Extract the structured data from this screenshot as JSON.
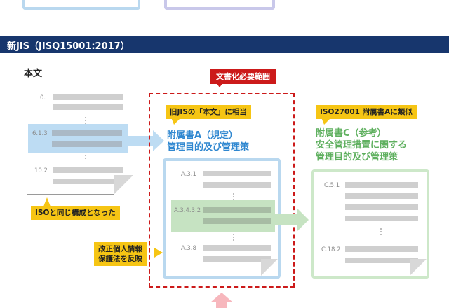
{
  "section": {
    "title": "新JIS（JISQ15001:2017）"
  },
  "honbun": {
    "label": "本文",
    "refs": [
      "0.",
      "6.1.3",
      "10.2"
    ],
    "callout": "ISOと同じ構成となった"
  },
  "scope": {
    "label": "文書化必要範囲"
  },
  "annex_a": {
    "callout": "旧JISの「本文」に相当",
    "heading_line1": "附属書A（規定）",
    "heading_line2": "管理目的及び管理策",
    "refs": [
      "A.3.1",
      "A.3.4.3.2",
      "A.3.8"
    ]
  },
  "revision_callout": {
    "line1": "改正個人情報",
    "line2": "保護法を反映"
  },
  "annex_c": {
    "callout": "ISO27001 附属書Aに類似",
    "heading_line1": "附属書C（参考）",
    "heading_line2": "安全管理措置に関する",
    "heading_line3": "管理目的及び管理策",
    "refs": [
      "C.5.1",
      "C.18.2"
    ]
  },
  "colors": {
    "navy": "#17366d",
    "red": "#cc1a1a",
    "yellow": "#f6c514",
    "blue": "#2f87d0",
    "light_blue": "#b9d8ef",
    "green": "#5fb05f",
    "light_green": "#cde8c9",
    "pink": "#f7b7bd"
  }
}
